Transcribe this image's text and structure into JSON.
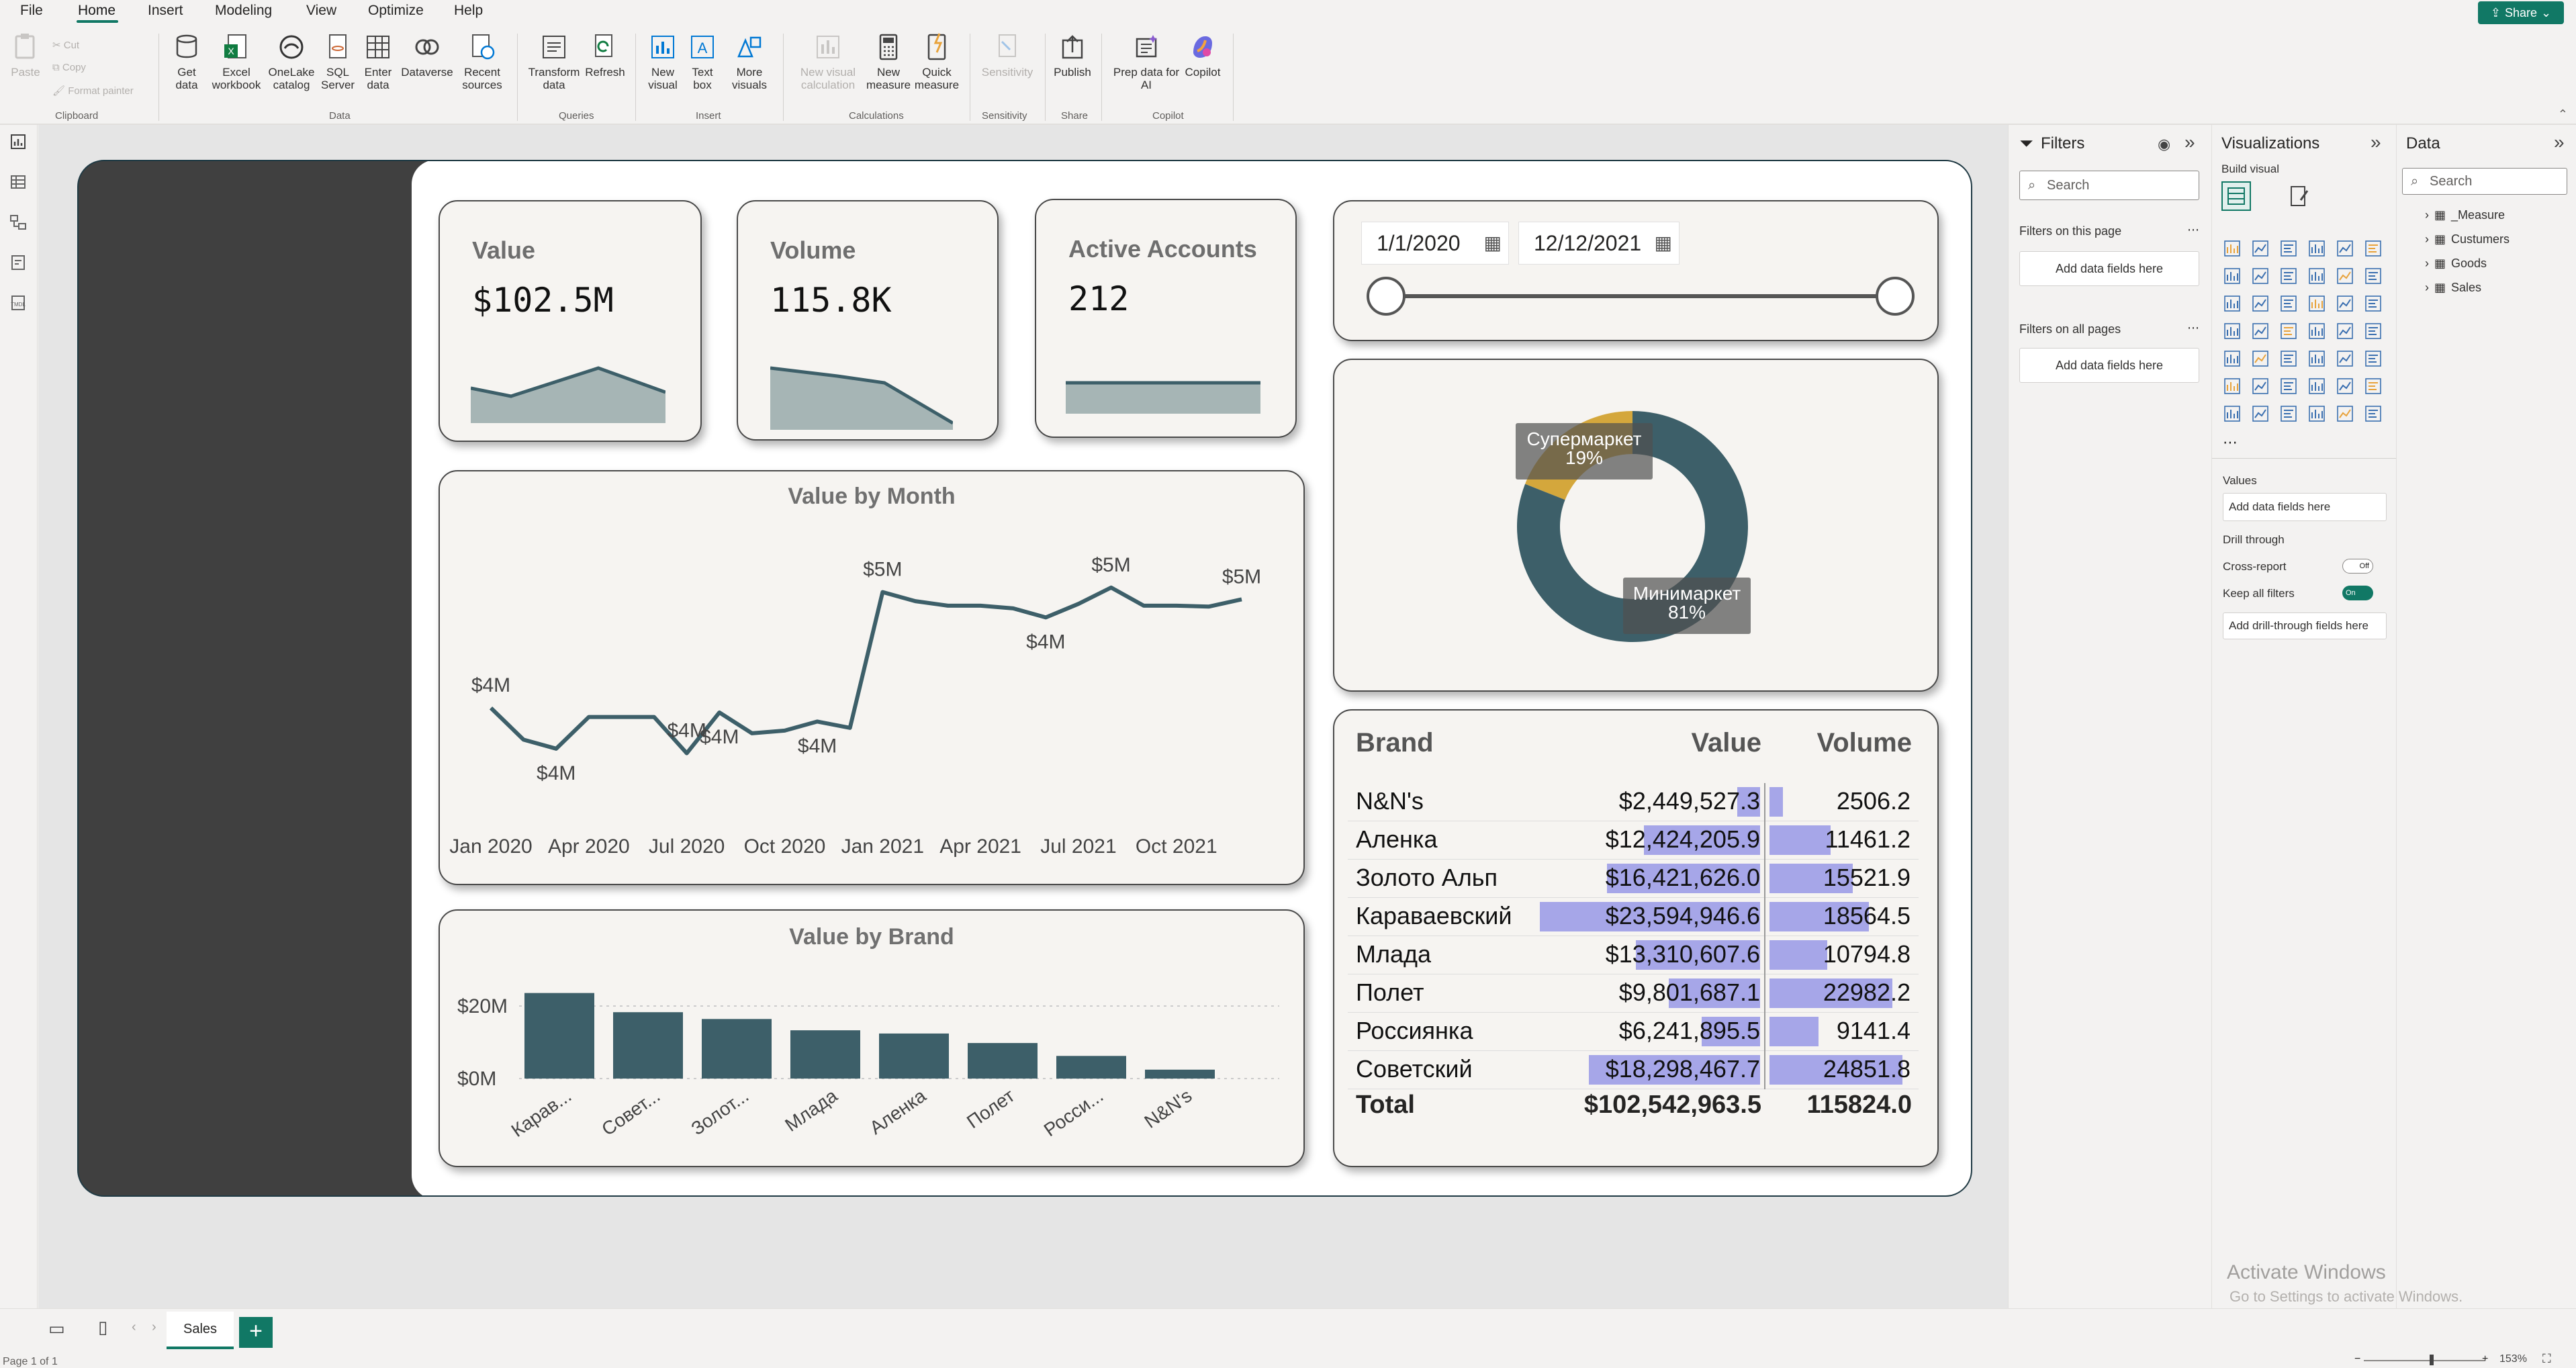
{
  "menu": {
    "items": [
      "File",
      "Home",
      "Insert",
      "Modeling",
      "View",
      "Optimize",
      "Help"
    ],
    "share_label": "Share"
  },
  "ribbon": {
    "clipboard": {
      "paste": "Paste",
      "cut": "Cut",
      "copy": "Copy",
      "format_painter": "Format painter",
      "label": "Clipboard"
    },
    "data": {
      "get_data": "Get data",
      "excel": "Excel workbook",
      "onelake": "OneLake catalog",
      "sql": "SQL Server",
      "enter_data": "Enter data",
      "dataverse": "Dataverse",
      "recent": "Recent sources",
      "label": "Data"
    },
    "queries": {
      "transform": "Transform data",
      "refresh": "Refresh",
      "label": "Queries"
    },
    "insert": {
      "new_visual": "New visual",
      "text_box": "Text box",
      "more_visuals": "More visuals",
      "label": "Insert"
    },
    "calculations": {
      "new_visual_calc": "New visual calculation",
      "new_measure": "New measure",
      "quick_measure": "Quick measure",
      "label": "Calculations"
    },
    "sensitivity": {
      "sensitivity": "Sensitivity",
      "label": "Sensitivity"
    },
    "share": {
      "publish": "Publish",
      "label": "Share"
    },
    "copilot": {
      "prep": "Prep data for AI",
      "copilot": "Copilot",
      "label": "Copilot"
    }
  },
  "kpis": [
    {
      "title": "Value",
      "value": "$102.5M"
    },
    {
      "title": "Volume",
      "value": "115.8K"
    },
    {
      "title": "Active Accounts",
      "value": "212"
    }
  ],
  "date_slicer": {
    "start": "1/1/2020",
    "end": "12/12/2021"
  },
  "donut": {
    "slices": [
      {
        "name": "Супермаркет",
        "pct": "19%",
        "value": 19,
        "color": "#d4a73c"
      },
      {
        "name": "Минимаркет",
        "pct": "81%",
        "value": 81,
        "color": "#3d5f69"
      }
    ]
  },
  "line_chart": {
    "title": "Value by Month",
    "x_ticks": [
      "Jan 2020",
      "Apr 2020",
      "Jul 2020",
      "Oct 2020",
      "Jan 2021",
      "Apr 2021",
      "Jul 2021",
      "Oct 2021"
    ],
    "data_labels": [
      "$4M",
      "$4M",
      "$4M",
      "$4M",
      "$4M",
      "$5M",
      "$4M",
      "$5M",
      "$5M"
    ]
  },
  "bar_chart": {
    "title": "Value by Brand",
    "y_ticks": [
      "$20M",
      "$0M"
    ],
    "categories": [
      "Карав...",
      "Совет...",
      "Золот...",
      "Млада",
      "Аленка",
      "Полет",
      "Росси...",
      "N&N's"
    ]
  },
  "table": {
    "headers": {
      "brand": "Brand",
      "value": "Value",
      "volume": "Volume"
    },
    "rows": [
      {
        "brand": "N&N's",
        "value": "$2,449,527.3",
        "volume": "2506.2",
        "vbar": 0.104,
        "qbar": 0.101
      },
      {
        "brand": "Аленка",
        "value": "$12,424,205.9",
        "volume": "11461.2",
        "vbar": 0.527,
        "qbar": 0.461
      },
      {
        "brand": "Золото Альп",
        "value": "$16,421,626.0",
        "volume": "15521.9",
        "vbar": 0.696,
        "qbar": 0.625
      },
      {
        "brand": "Караваевский",
        "value": "$23,594,946.6",
        "volume": "18564.5",
        "vbar": 1.0,
        "qbar": 0.747
      },
      {
        "brand": "Млада",
        "value": "$13,310,607.6",
        "volume": "10794.8",
        "vbar": 0.564,
        "qbar": 0.434
      },
      {
        "brand": "Полет",
        "value": "$9,801,687.1",
        "volume": "22982.2",
        "vbar": 0.415,
        "qbar": 0.925
      },
      {
        "brand": "Россиянка",
        "value": "$6,241,895.5",
        "volume": "9141.4",
        "vbar": 0.265,
        "qbar": 0.368
      },
      {
        "brand": "Советский",
        "value": "$18,298,467.7",
        "volume": "24851.8",
        "vbar": 0.776,
        "qbar": 1.0
      }
    ],
    "total": {
      "label": "Total",
      "value": "$102,542,963.5",
      "volume": "115824.0"
    }
  },
  "chart_data": [
    {
      "type": "line",
      "title": "Value by Month",
      "x": [
        "Jan 2020",
        "Feb 2020",
        "Mar 2020",
        "Apr 2020",
        "May 2020",
        "Jun 2020",
        "Jul 2020",
        "Aug 2020",
        "Sep 2020",
        "Oct 2020",
        "Nov 2020",
        "Dec 2020",
        "Jan 2021",
        "Feb 2021",
        "Mar 2021",
        "Apr 2021",
        "May 2021",
        "Jun 2021",
        "Jul 2021",
        "Aug 2021",
        "Sep 2021",
        "Oct 2021",
        "Nov 2021",
        "Dec 2021"
      ],
      "values": [
        3.8,
        3.45,
        3.35,
        3.7,
        3.7,
        3.7,
        3.3,
        3.75,
        3.52,
        3.55,
        3.65,
        3.58,
        5.08,
        4.98,
        4.93,
        4.93,
        4.9,
        4.8,
        4.95,
        5.13,
        4.93,
        4.93,
        4.92,
        5.0
      ],
      "units": "$M"
    },
    {
      "type": "bar",
      "title": "Value by Brand",
      "categories": [
        "Караваевский",
        "Советский",
        "Золото Альп",
        "Млада",
        "Аленка",
        "Полет",
        "Россиянка",
        "N&N's"
      ],
      "values": [
        23.59,
        18.3,
        16.42,
        13.31,
        12.42,
        9.8,
        6.24,
        2.45
      ],
      "units": "$M",
      "ylim": [
        0,
        25
      ]
    },
    {
      "type": "pie",
      "categories": [
        "Супермаркет",
        "Минимаркет"
      ],
      "values": [
        19,
        81
      ]
    }
  ],
  "filters": {
    "title": "Filters",
    "search": "Search",
    "on_page": "Filters on this page",
    "on_all": "Filters on all pages",
    "add": "Add data fields here"
  },
  "viz": {
    "title": "Visualizations",
    "build": "Build visual",
    "values": "Values",
    "add": "Add data fields here",
    "drill": "Drill through",
    "cross": "Cross-report",
    "cross_state": "Off",
    "keep": "Keep all filters",
    "keep_state": "On",
    "add_drill": "Add drill-through fields here"
  },
  "data_pane": {
    "title": "Data",
    "search": "Search",
    "tables": [
      "_Measure",
      "Custumers",
      "Goods",
      "Sales"
    ]
  },
  "bottom": {
    "tab": "Sales",
    "status": "Page 1 of 1",
    "zoom": "153%"
  },
  "watermark": {
    "line1": "Activate Windows",
    "line2": "Go to Settings to activate Windows."
  }
}
